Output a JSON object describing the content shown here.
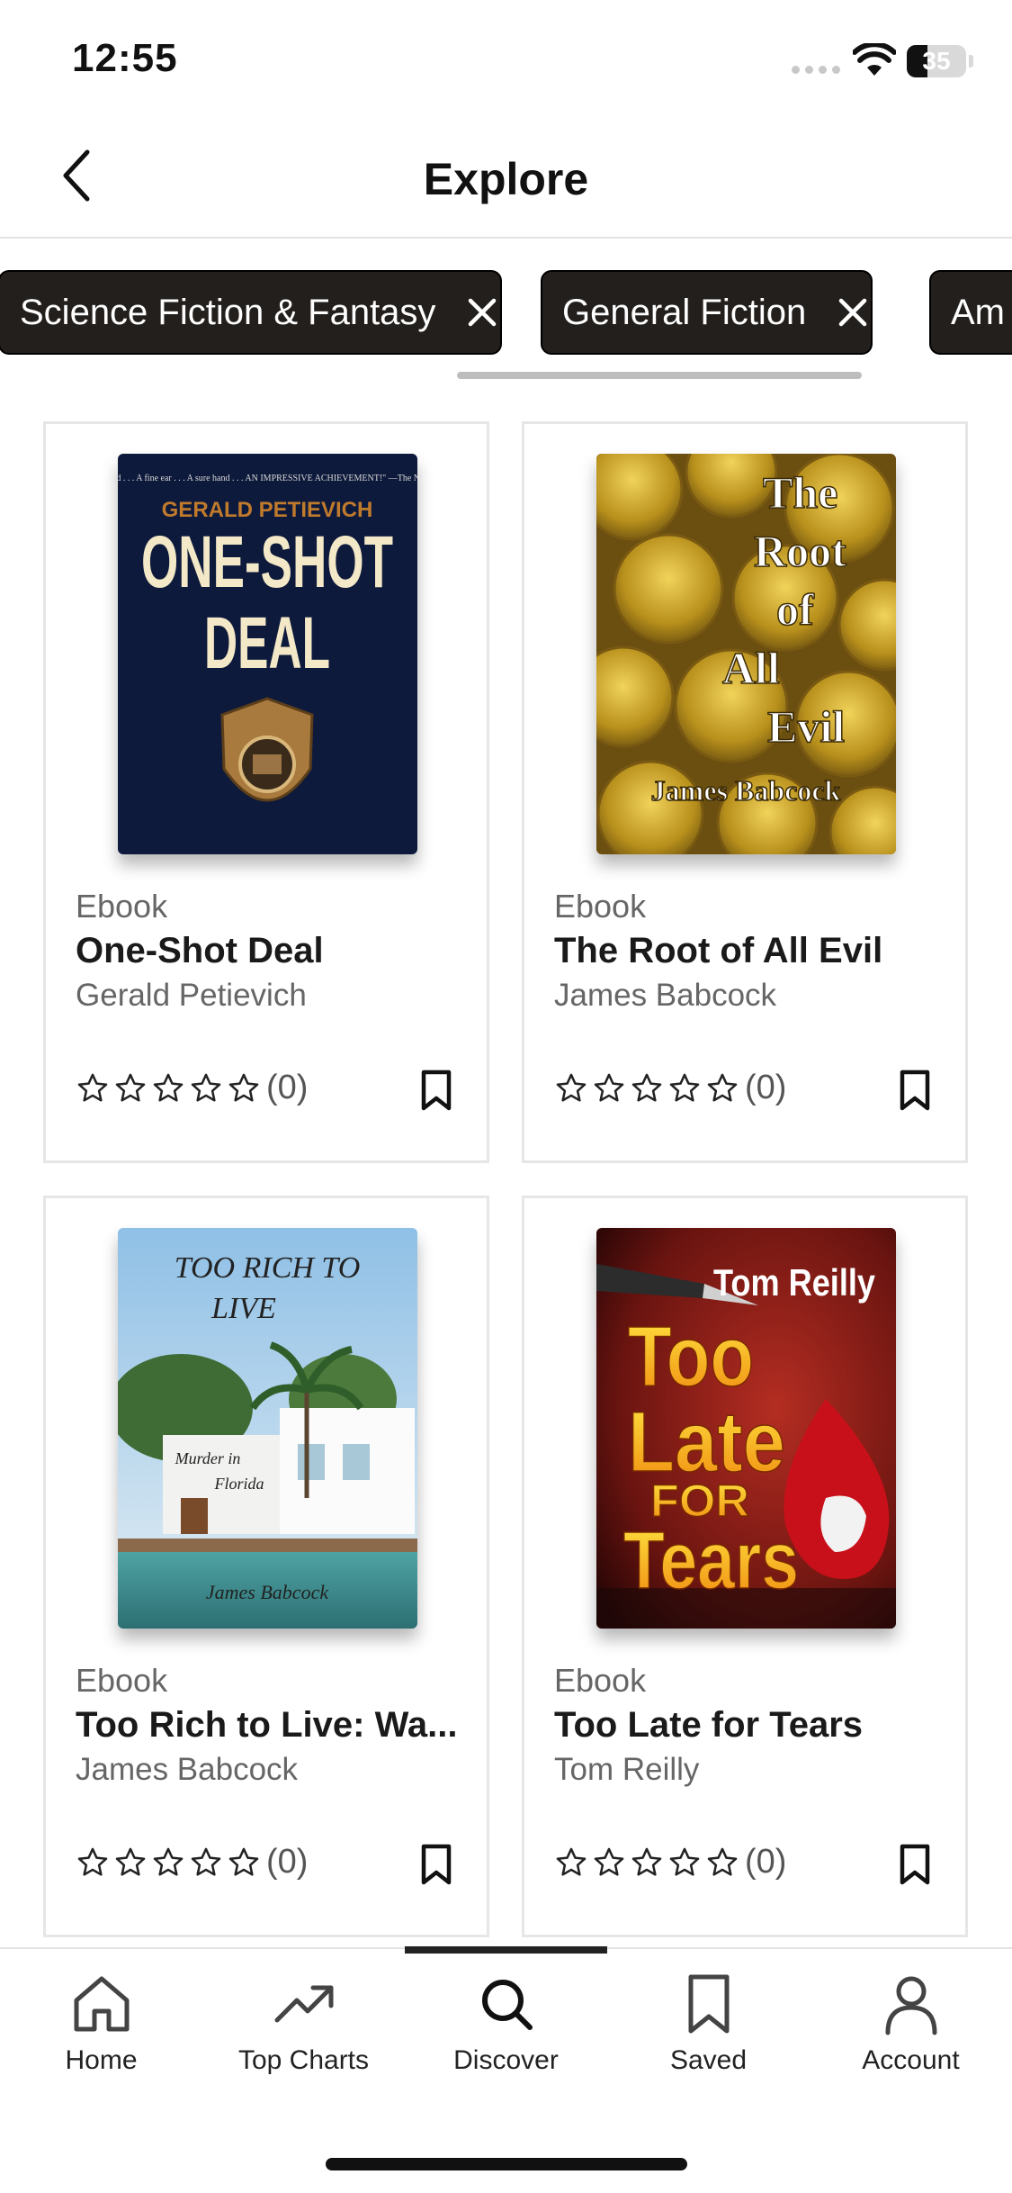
{
  "status_bar": {
    "time": "12:55",
    "battery_level": "35",
    "battery_fraction": 0.35
  },
  "header": {
    "title": "Explore",
    "back_icon": "chevron-left-icon"
  },
  "filters": [
    {
      "label": "Science Fiction & Fantasy"
    },
    {
      "label": "General Fiction"
    },
    {
      "label": "Am"
    }
  ],
  "books": [
    {
      "type": "Ebook",
      "title": "One-Shot Deal",
      "author": "Gerald Petievich",
      "rating_count": "(0)",
      "stars": 0,
      "cover": {
        "quote": "\"Unusually good . . . A fine ear . . . A sure hand . . . AN IMPRESSIVE ACHIEVEMENT!\" —The New York Times",
        "author": "GERALD PETIEVICH",
        "title_line1": "ONE-SHOT",
        "title_line2": "DEAL"
      }
    },
    {
      "type": "Ebook",
      "title": "The Root of All Evil",
      "author": "James Babcock",
      "rating_count": "(0)",
      "stars": 0,
      "cover": {
        "w1": "The",
        "w2": "Root",
        "w3": "of",
        "w4": "All",
        "w5": "Evil",
        "author": "James Babcock"
      }
    },
    {
      "type": "Ebook",
      "title": "Too Rich to Live: Wa...",
      "author": "James Babcock",
      "rating_count": "(0)",
      "stars": 0,
      "cover": {
        "title_line1": "TOO RICH TO",
        "title_line2": "LIVE",
        "subtitle_line1": "Murder in",
        "subtitle_line2": "Florida",
        "author": "James Babcock"
      }
    },
    {
      "type": "Ebook",
      "title": "Too Late for Tears",
      "author": "Tom Reilly",
      "rating_count": "(0)",
      "stars": 0,
      "cover": {
        "author": "Tom Reilly",
        "w1": "Too",
        "w2": "Late",
        "w3": "FOR",
        "w4": "Tears"
      }
    }
  ],
  "nav": [
    {
      "label": "Home",
      "icon": "house-icon"
    },
    {
      "label": "Top Charts",
      "icon": "trending-up-icon"
    },
    {
      "label": "Discover",
      "icon": "search-icon",
      "active": true
    },
    {
      "label": "Saved",
      "icon": "bookmark-icon"
    },
    {
      "label": "Account",
      "icon": "person-icon"
    }
  ],
  "colors": {
    "chip_bg": "#231f1c",
    "active_indicator": "#222222",
    "card_border": "#e6e6e6"
  }
}
